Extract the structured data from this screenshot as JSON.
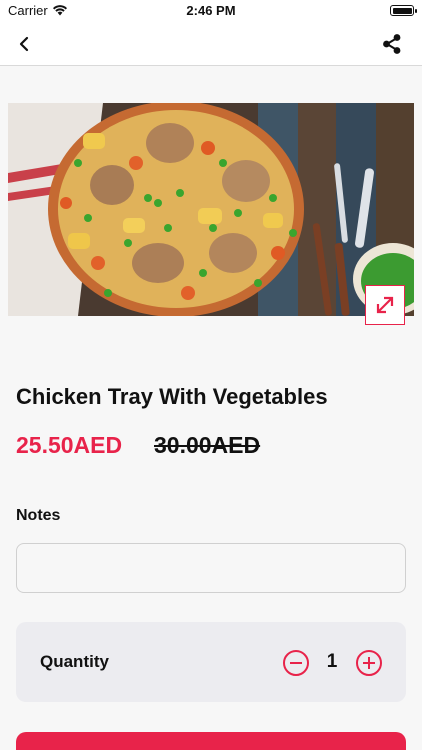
{
  "status_bar": {
    "carrier": "Carrier",
    "time": "2:46 PM"
  },
  "nav": {
    "back_icon": "chevron-left-icon",
    "share_icon": "share-icon"
  },
  "product": {
    "title": "Chicken Tray With Vegetables",
    "price_current": "25.50AED",
    "price_old": "30.00AED",
    "image_icon": "expand-icon"
  },
  "notes": {
    "label": "Notes",
    "value": "",
    "placeholder": ""
  },
  "quantity": {
    "label": "Quantity",
    "value": "1"
  },
  "colors": {
    "accent": "#e8234a",
    "background": "#f7f7f7",
    "card": "#ececf0"
  }
}
